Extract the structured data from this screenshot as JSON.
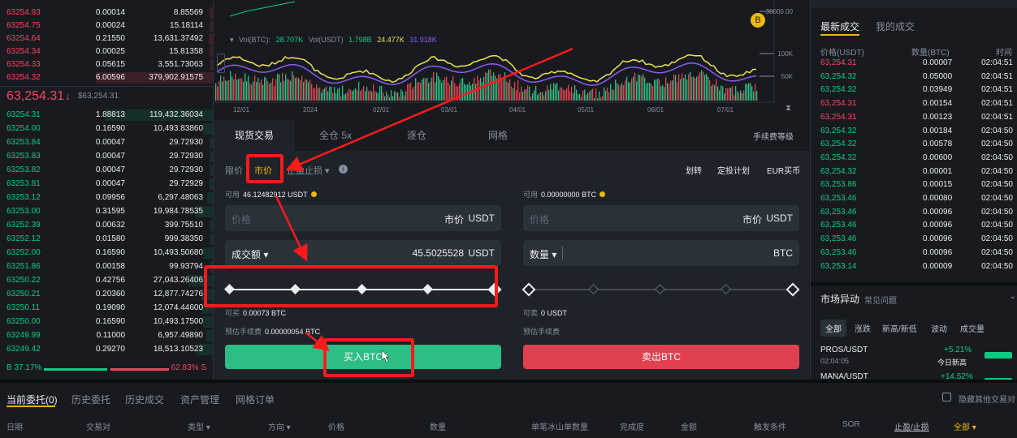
{
  "order_book": {
    "asks": [
      {
        "price": "63254.93",
        "amount": "0.00014",
        "total": "8.85569"
      },
      {
        "price": "63254.75",
        "amount": "0.00024",
        "total": "15.18114"
      },
      {
        "price": "63254.64",
        "amount": "0.21550",
        "total": "13,631.37492"
      },
      {
        "price": "63254.34",
        "amount": "0.00025",
        "total": "15.81358"
      },
      {
        "price": "63254.33",
        "amount": "0.05615",
        "total": "3,551.73063"
      },
      {
        "price": "63254.32",
        "amount": "6.00596",
        "total": "379,902.91575"
      }
    ],
    "mid_price": "63,254.31",
    "mid_arrow": "↓",
    "mid_fiat": "$63,254.31",
    "bids": [
      {
        "price": "63254.31",
        "amount": "1.88813",
        "total": "119,432.36034"
      },
      {
        "price": "63254.00",
        "amount": "0.16590",
        "total": "10,493.83860"
      },
      {
        "price": "63253.84",
        "amount": "0.00047",
        "total": "29.72930"
      },
      {
        "price": "63253.83",
        "amount": "0.00047",
        "total": "29.72930"
      },
      {
        "price": "63253.82",
        "amount": "0.00047",
        "total": "29.72930"
      },
      {
        "price": "63253.81",
        "amount": "0.00047",
        "total": "29.72929"
      },
      {
        "price": "63253.12",
        "amount": "0.09956",
        "total": "6,297.48063"
      },
      {
        "price": "63253.00",
        "amount": "0.31595",
        "total": "19,984.78535"
      },
      {
        "price": "63252.39",
        "amount": "0.00632",
        "total": "399.75510"
      },
      {
        "price": "63252.12",
        "amount": "0.01580",
        "total": "999.38350"
      },
      {
        "price": "63252.00",
        "amount": "0.16590",
        "total": "10,493.50680"
      },
      {
        "price": "63251.86",
        "amount": "0.00158",
        "total": "99.93794"
      },
      {
        "price": "63250.22",
        "amount": "0.42756",
        "total": "27,043.26406"
      },
      {
        "price": "63250.21",
        "amount": "0.20360",
        "total": "12,877.74276"
      },
      {
        "price": "63250.11",
        "amount": "0.19090",
        "total": "12,074.44600"
      },
      {
        "price": "63250.00",
        "amount": "0.16590",
        "total": "10,493.17500"
      },
      {
        "price": "63249.99",
        "amount": "0.11000",
        "total": "6,957.49890"
      },
      {
        "price": "63249.42",
        "amount": "0.29270",
        "total": "18,513.10523"
      }
    ],
    "buy_ratio": "B 37.17%",
    "sell_ratio": "62.83% S"
  },
  "chart": {
    "vol_label": "Vol(BTC):",
    "vol_btc": "28.707K",
    "vol_usdt_label": "Vol(USDT)",
    "vol_usdt": "1.798B",
    "ma1": "24.477K",
    "ma2": "31.918K",
    "y_ticks": [
      "30000.00",
      "100K",
      "50K"
    ],
    "x_ticks": [
      "12/01",
      "2024",
      "02/01",
      "03/01",
      "04/01",
      "05/01",
      "06/01",
      "07/01"
    ],
    "badge": "B",
    "expand_icon": "›"
  },
  "trade": {
    "tabs": [
      "现货交易",
      "全仓 5x",
      "逐仓",
      "网格"
    ],
    "fee_link": "手续费等级",
    "order_types": {
      "limit": "限价",
      "market": "市价",
      "stop": "止盈止损 ▾",
      "info": "i"
    },
    "links": [
      "划转",
      "定投计划",
      "EUR买币"
    ],
    "buy": {
      "avail_label": "可用",
      "avail_value": "46.12482912 USDT",
      "price_label": "价格",
      "price_value": "市价",
      "price_unit": "USDT",
      "amount_label": "成交额 ▾",
      "amount_value": "45.5025528",
      "amount_unit": "USDT",
      "slider_percent": 100,
      "can_buy_label": "可买",
      "can_buy_value": "0.00073 BTC",
      "fee_label": "预估手续费",
      "fee_value": "0.00000054 BTC",
      "button": "买入BTC"
    },
    "sell": {
      "avail_label": "可用",
      "avail_value": "0.00000000 BTC",
      "price_label": "价格",
      "price_value": "市价",
      "price_unit": "USDT",
      "amount_label": "数量 ▾",
      "amount_unit": "BTC",
      "slider_percent": 0,
      "can_sell_label": "可卖",
      "can_sell_value": "0 USDT",
      "fee_label": "预估手续费",
      "button": "卖出BTC"
    }
  },
  "trades": {
    "tabs": [
      "最新成交",
      "我的成交"
    ],
    "headers": [
      "价格(USDT)",
      "数量(BTC)",
      "时间"
    ],
    "rows": [
      {
        "price": "63,254.31",
        "amount": "0.00007",
        "time": "02:04:51",
        "side": "sell"
      },
      {
        "price": "63,254.32",
        "amount": "0.05000",
        "time": "02:04:51",
        "side": "buy"
      },
      {
        "price": "63,254.32",
        "amount": "0.03949",
        "time": "02:04:51",
        "side": "buy"
      },
      {
        "price": "63,254.31",
        "amount": "0.00154",
        "time": "02:04:51",
        "side": "sell"
      },
      {
        "price": "63,254.31",
        "amount": "0.00123",
        "time": "02:04:51",
        "side": "sell"
      },
      {
        "price": "63,254.32",
        "amount": "0.00184",
        "time": "02:04:50",
        "side": "buy"
      },
      {
        "price": "63,254.32",
        "amount": "0.00578",
        "time": "02:04:50",
        "side": "buy"
      },
      {
        "price": "63,254.32",
        "amount": "0.00600",
        "time": "02:04:50",
        "side": "buy"
      },
      {
        "price": "63,254.32",
        "amount": "0.00001",
        "time": "02:04:50",
        "side": "buy"
      },
      {
        "price": "63,253.86",
        "amount": "0.00015",
        "time": "02:04:50",
        "side": "buy"
      },
      {
        "price": "63,253.46",
        "amount": "0.00080",
        "time": "02:04:50",
        "side": "buy"
      },
      {
        "price": "63,253.46",
        "amount": "0.00096",
        "time": "02:04:50",
        "side": "buy"
      },
      {
        "price": "63,253.46",
        "amount": "0.00096",
        "time": "02:04:50",
        "side": "buy"
      },
      {
        "price": "63,253.46",
        "amount": "0.00096",
        "time": "02:04:50",
        "side": "buy"
      },
      {
        "price": "63,253.46",
        "amount": "0.00096",
        "time": "02:04:50",
        "side": "buy"
      },
      {
        "price": "63,253.14",
        "amount": "0.00009",
        "time": "02:04:50",
        "side": "buy"
      }
    ]
  },
  "market_moves": {
    "title": "市场异动",
    "subtitle": "常见问题",
    "filters": [
      "全部",
      "涨跌",
      "新高/新低",
      "波动",
      "成交量"
    ],
    "items": [
      {
        "pair": "PROS/USDT",
        "time": "02:04:05",
        "change": "+5.21%",
        "note": "今日新高"
      },
      {
        "pair": "MANA/USDT",
        "time": "",
        "change": "+14.52%",
        "note": ""
      }
    ]
  },
  "bottom": {
    "tabs": [
      "当前委托(0)",
      "历史委托",
      "历史成交",
      "资产管理",
      "网格订单"
    ],
    "hide_label": "隐藏其他交易对",
    "columns": [
      "日期",
      "交易对",
      "类型 ▾",
      "方向 ▾",
      "价格",
      "数量",
      "单笔冰山单数量",
      "完成度",
      "金额",
      "触发条件",
      "SOR",
      "止盈/止损",
      "全部 ▾"
    ]
  },
  "colors": {
    "up": "#0ecb81",
    "down": "#f6465d",
    "accent": "#f0b90b",
    "annotation": "#ff1a1a"
  }
}
